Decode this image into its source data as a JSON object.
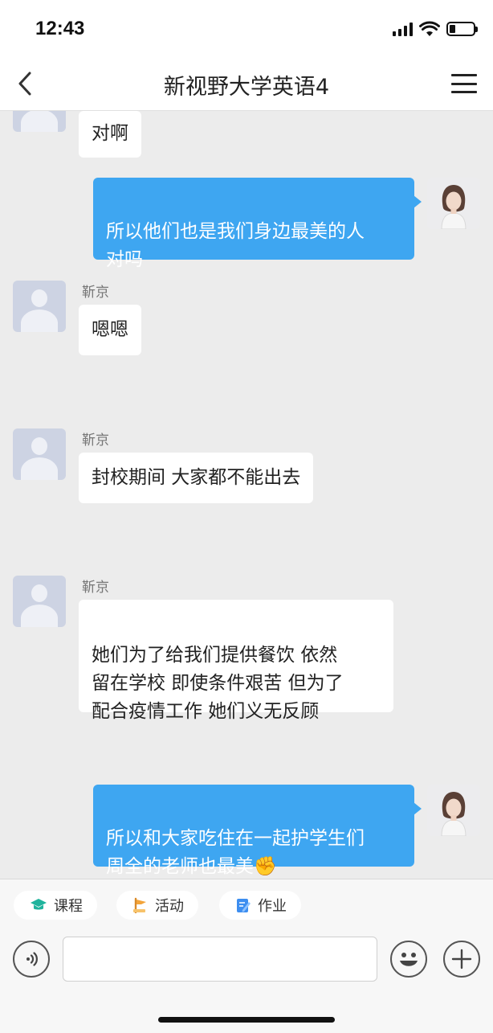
{
  "status_bar": {
    "time": "12:43"
  },
  "nav": {
    "title": "新视野大学英语4"
  },
  "messages": [
    {
      "id": "m1",
      "side": "in",
      "sender": "",
      "text": "对啊"
    },
    {
      "id": "m2",
      "side": "out",
      "text": "所以他们也是我们身边最美的人\n对吗"
    },
    {
      "id": "m3",
      "side": "in",
      "sender": "靳京",
      "text": "嗯嗯"
    },
    {
      "id": "m4",
      "side": "in",
      "sender": "靳京",
      "text": "封校期间 大家都不能出去"
    },
    {
      "id": "m5",
      "side": "in",
      "sender": "靳京",
      "text": "她们为了给我们提供餐饮 依然\n留在学校 即使条件艰苦 但为了\n配合疫情工作 她们义无反顾"
    },
    {
      "id": "m6",
      "side": "out",
      "text": "所以和大家吃住在一起护学生们\n周全的老师也最美",
      "emoji": "✊"
    }
  ],
  "toolbar": {
    "chips": [
      {
        "label": "课程",
        "icon": "graduation-cap-icon",
        "color": "#1fb39c"
      },
      {
        "label": "活动",
        "icon": "flag-icon",
        "color": "#f3a43a"
      },
      {
        "label": "作业",
        "icon": "document-edit-icon",
        "color": "#3d8ef0"
      }
    ],
    "input_value": "",
    "input_placeholder": ""
  },
  "colors": {
    "out_bubble": "#3ea6f1",
    "background": "#ececec"
  }
}
